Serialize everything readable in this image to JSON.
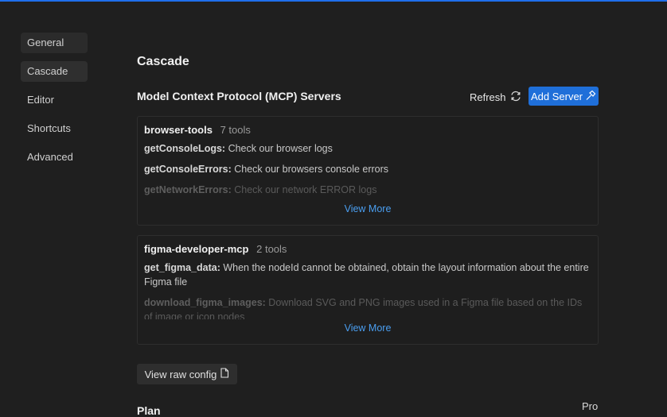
{
  "sidebar": {
    "items": [
      {
        "label": "General"
      },
      {
        "label": "Cascade"
      },
      {
        "label": "Editor"
      },
      {
        "label": "Shortcuts"
      },
      {
        "label": "Advanced"
      }
    ],
    "selected": "Cascade"
  },
  "main": {
    "section_title": "Cascade",
    "mcp": {
      "title": "Model Context Protocol (MCP) Servers",
      "refresh_label": "Refresh",
      "add_server_label": "Add Server",
      "servers": [
        {
          "name": "browser-tools",
          "tool_count": "7 tools",
          "tools": [
            {
              "name": "getConsoleLogs:",
              "desc": " Check our browser logs"
            },
            {
              "name": "getConsoleErrors:",
              "desc": " Check our browsers console errors"
            },
            {
              "name": "getNetworkErrors:",
              "desc": " Check our network ERROR logs"
            }
          ],
          "view_more": "View More"
        },
        {
          "name": "figma-developer-mcp",
          "tool_count": "2 tools",
          "tools": [
            {
              "name": "get_figma_data:",
              "desc": " When the nodeId cannot be obtained, obtain the layout information about the entire Figma file"
            },
            {
              "name": "download_figma_images:",
              "desc": " Download SVG and PNG images used in a Figma file based on the IDs of image or icon nodes"
            }
          ],
          "view_more": "View More"
        }
      ],
      "raw_config_label": "View raw config"
    },
    "plan_title": "Plan",
    "plan_value": "Pro"
  },
  "colors": {
    "accent": "#1f6fd9",
    "link": "#4a9ef0",
    "background": "#1f1f1f"
  }
}
